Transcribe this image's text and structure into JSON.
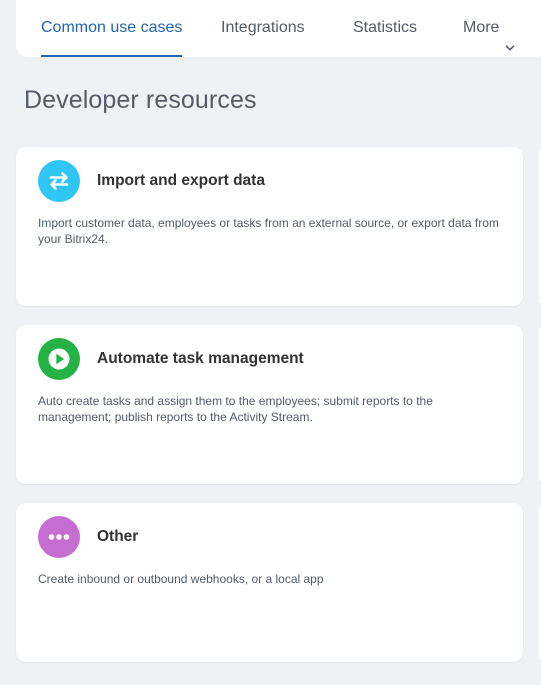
{
  "tabs": [
    {
      "label": "Common use cases",
      "active": true
    },
    {
      "label": "Integrations",
      "active": false
    },
    {
      "label": "Statistics",
      "active": false
    },
    {
      "label": "More",
      "active": false
    }
  ],
  "page": {
    "title": "Developer resources"
  },
  "cards": [
    {
      "title": "Import and export data",
      "description": "Import customer data, employees or tasks from an external source, or export data from your Bitrix24.",
      "icon": "arrows-swap-icon",
      "icon_color": "#2fc6f6"
    },
    {
      "title": "Automate task management",
      "description": "Auto create tasks and assign them to the employees; submit reports to the management; publish reports to the Activity Stream.",
      "icon": "play-icon",
      "icon_color": "#25b245"
    },
    {
      "title": "Other",
      "description": "Create inbound or outbound webhooks, or a local app",
      "icon": "more-dots-icon",
      "icon_color": "#c66dd2"
    }
  ],
  "colors": {
    "accent": "#2067b0",
    "background": "#eef2f4"
  }
}
